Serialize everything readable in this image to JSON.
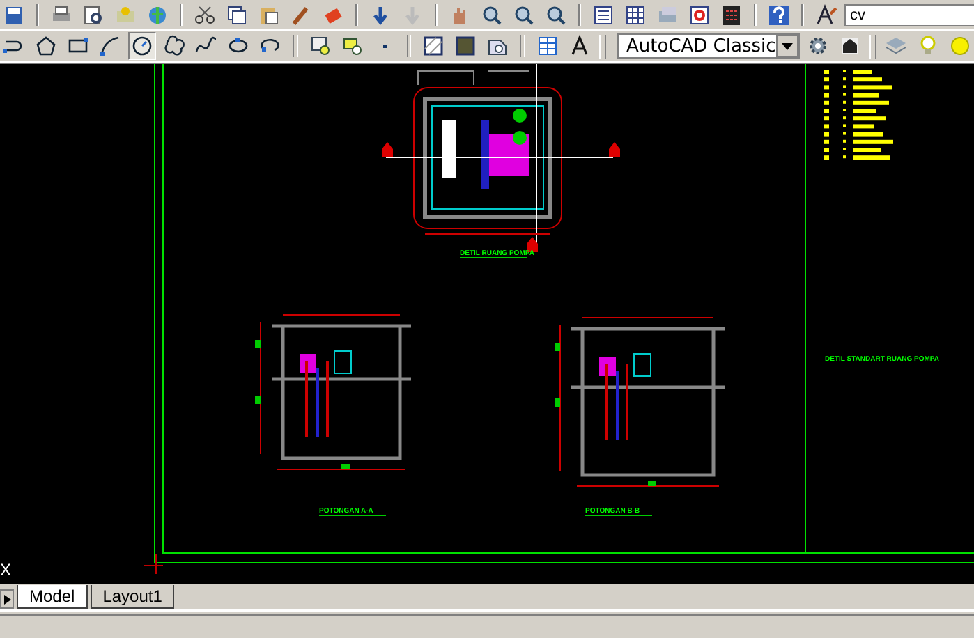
{
  "standard_toolbar": {
    "command_field": {
      "value": "cv"
    }
  },
  "draw_toolbar": {
    "tools": [
      {
        "kind": "polyline",
        "selected": false
      },
      {
        "kind": "polygon",
        "selected": false
      },
      {
        "kind": "rectangle",
        "selected": false
      },
      {
        "kind": "arc",
        "selected": false
      },
      {
        "kind": "circle",
        "selected": true
      },
      {
        "kind": "cloud",
        "selected": false
      },
      {
        "kind": "spline",
        "selected": false
      },
      {
        "kind": "ellipse",
        "selected": false
      },
      {
        "kind": "ellipse-arc",
        "selected": false
      },
      {
        "kind": "insert-block",
        "selected": false
      },
      {
        "kind": "make-block",
        "selected": false
      },
      {
        "kind": "point",
        "selected": false
      },
      {
        "kind": "hatch",
        "selected": false
      },
      {
        "kind": "gradient",
        "selected": false
      },
      {
        "kind": "region",
        "selected": false
      },
      {
        "kind": "table",
        "selected": false
      },
      {
        "kind": "text",
        "selected": false
      }
    ],
    "workspace": {
      "value": "AutoCAD Classic"
    }
  },
  "canvas": {
    "drawings": [
      {
        "kind": "plan",
        "caption": "DETIL RUANG POMPA"
      },
      {
        "kind": "section",
        "caption": "POTONGAN A-A"
      },
      {
        "kind": "section",
        "caption": "POTONGAN B-B"
      }
    ],
    "side_title": "DETIL STANDART RUANG POMPA",
    "axis_label": "X"
  },
  "layout_tabs": [
    {
      "label": "Model",
      "selected": true
    },
    {
      "label": "Layout1",
      "selected": false
    }
  ]
}
